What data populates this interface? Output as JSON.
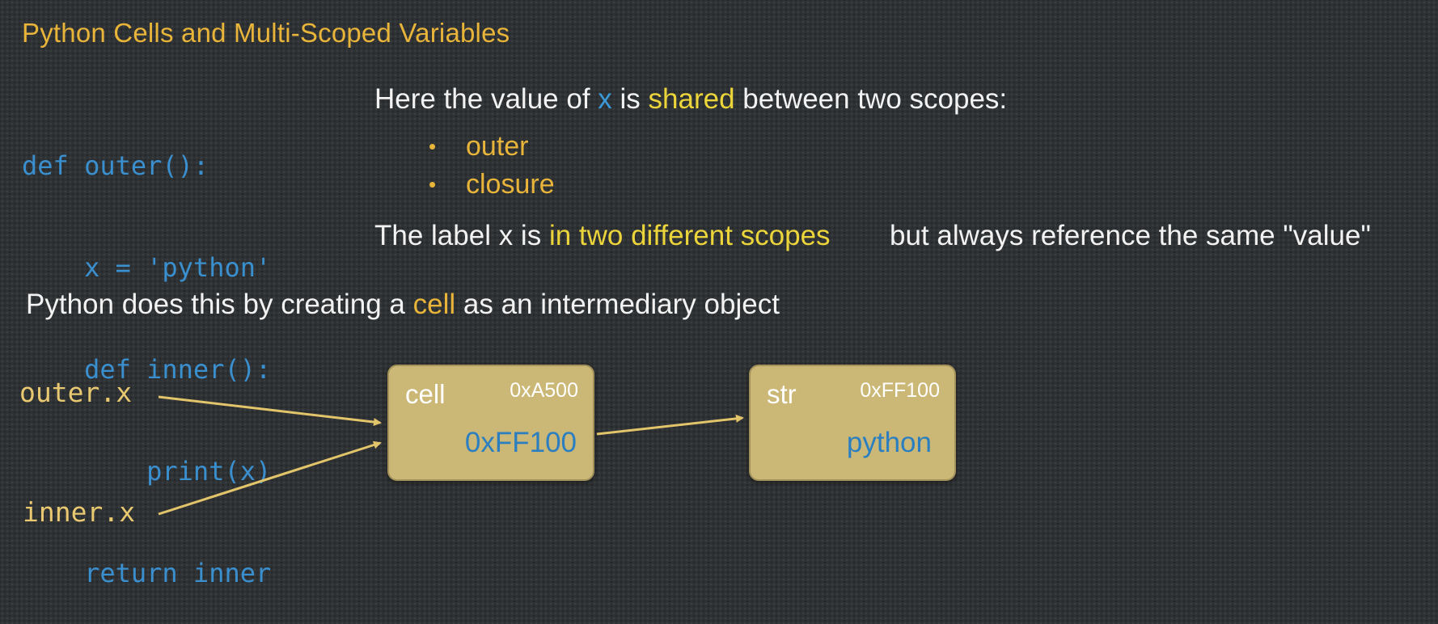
{
  "title": "Python Cells and Multi-Scoped Variables",
  "code_lines": [
    "def outer():",
    "    x = 'python'",
    "    def inner():",
    "        print(x)",
    "    return inner"
  ],
  "intro": {
    "part1": "Here the value of ",
    "var": "x",
    "part2": " is ",
    "shared": "shared",
    "part3": " between two scopes:"
  },
  "scopes": [
    "outer",
    "closure"
  ],
  "label_sentence": {
    "part1": "The label x is ",
    "highlight": "in two different scopes",
    "part2": "but always reference the same \"value\""
  },
  "cell_sentence": {
    "part1": "Python does this by creating a ",
    "highlight": "cell",
    "part2": " as an intermediary object"
  },
  "diagram": {
    "label_outer": "outer.x",
    "label_inner": "inner.x",
    "cell_box": {
      "type": "cell",
      "address": "0xA500",
      "value": "0xFF100"
    },
    "str_box": {
      "type": "str",
      "address": "0xFF100",
      "value": "python"
    }
  },
  "colors": {
    "background": "#2f3234",
    "title": "#e8b43a",
    "code": "#3a8fcf",
    "highlight": "#ecd53b",
    "box_fill": "#cbb776",
    "arrow": "#e2c46a"
  }
}
